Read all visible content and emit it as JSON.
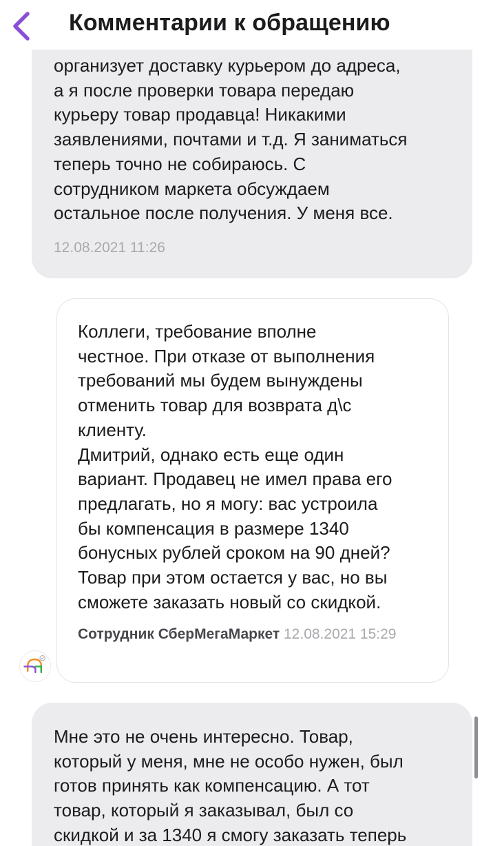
{
  "header": {
    "title": "Комментарии к обращению",
    "back_icon": "chevron-left-icon",
    "accent_color": "#8a4fd6"
  },
  "messages": [
    {
      "sender": "user",
      "text": "организует доставку курьером до адреса,\nа я после проверки товара передаю\nкурьеру товар продавца! Никакими\nзаявлениями, почтами и т.д. Я заниматься\nтеперь точно не собираюсь. С\nсотрудником маркета обсуждаем\nостальное после получения. У меня все.",
      "time": "12.08.2021 11:26"
    },
    {
      "sender": "support",
      "text": "Коллеги, требование вполне\nчестное. При отказе от выполнения\nтребований мы будем вынуждены\nотменить товар для возврата д\\с\nклиенту.\nДмитрий, однако есть еще один\nвариант. Продавец не имел права его\nпредлагать, но я могу: вас устроила\nбы компенсация в размере 1340\nбонусных рублей сроком на 90 дней?\nТовар при этом остается у вас, но вы\nсможете заказать новый со скидкой.",
      "author": "Сотрудник СберМегаМаркет",
      "time": "12.08.2021 15:29",
      "avatar_icon": "sbermegamarket-logo-icon"
    },
    {
      "sender": "user",
      "text": "Мне это не очень интересно. Товар,\nкоторый у меня, мне не особо нужен, был\nготов принять как компенсацию. А тот\nтовар, который я заказывал, был со\nскидкой и за 1340 я смогу заказать теперь"
    }
  ],
  "colors": {
    "user_bubble": "#ececef",
    "support_border": "#e4e4e8",
    "timestamp": "#a9a9ae"
  }
}
